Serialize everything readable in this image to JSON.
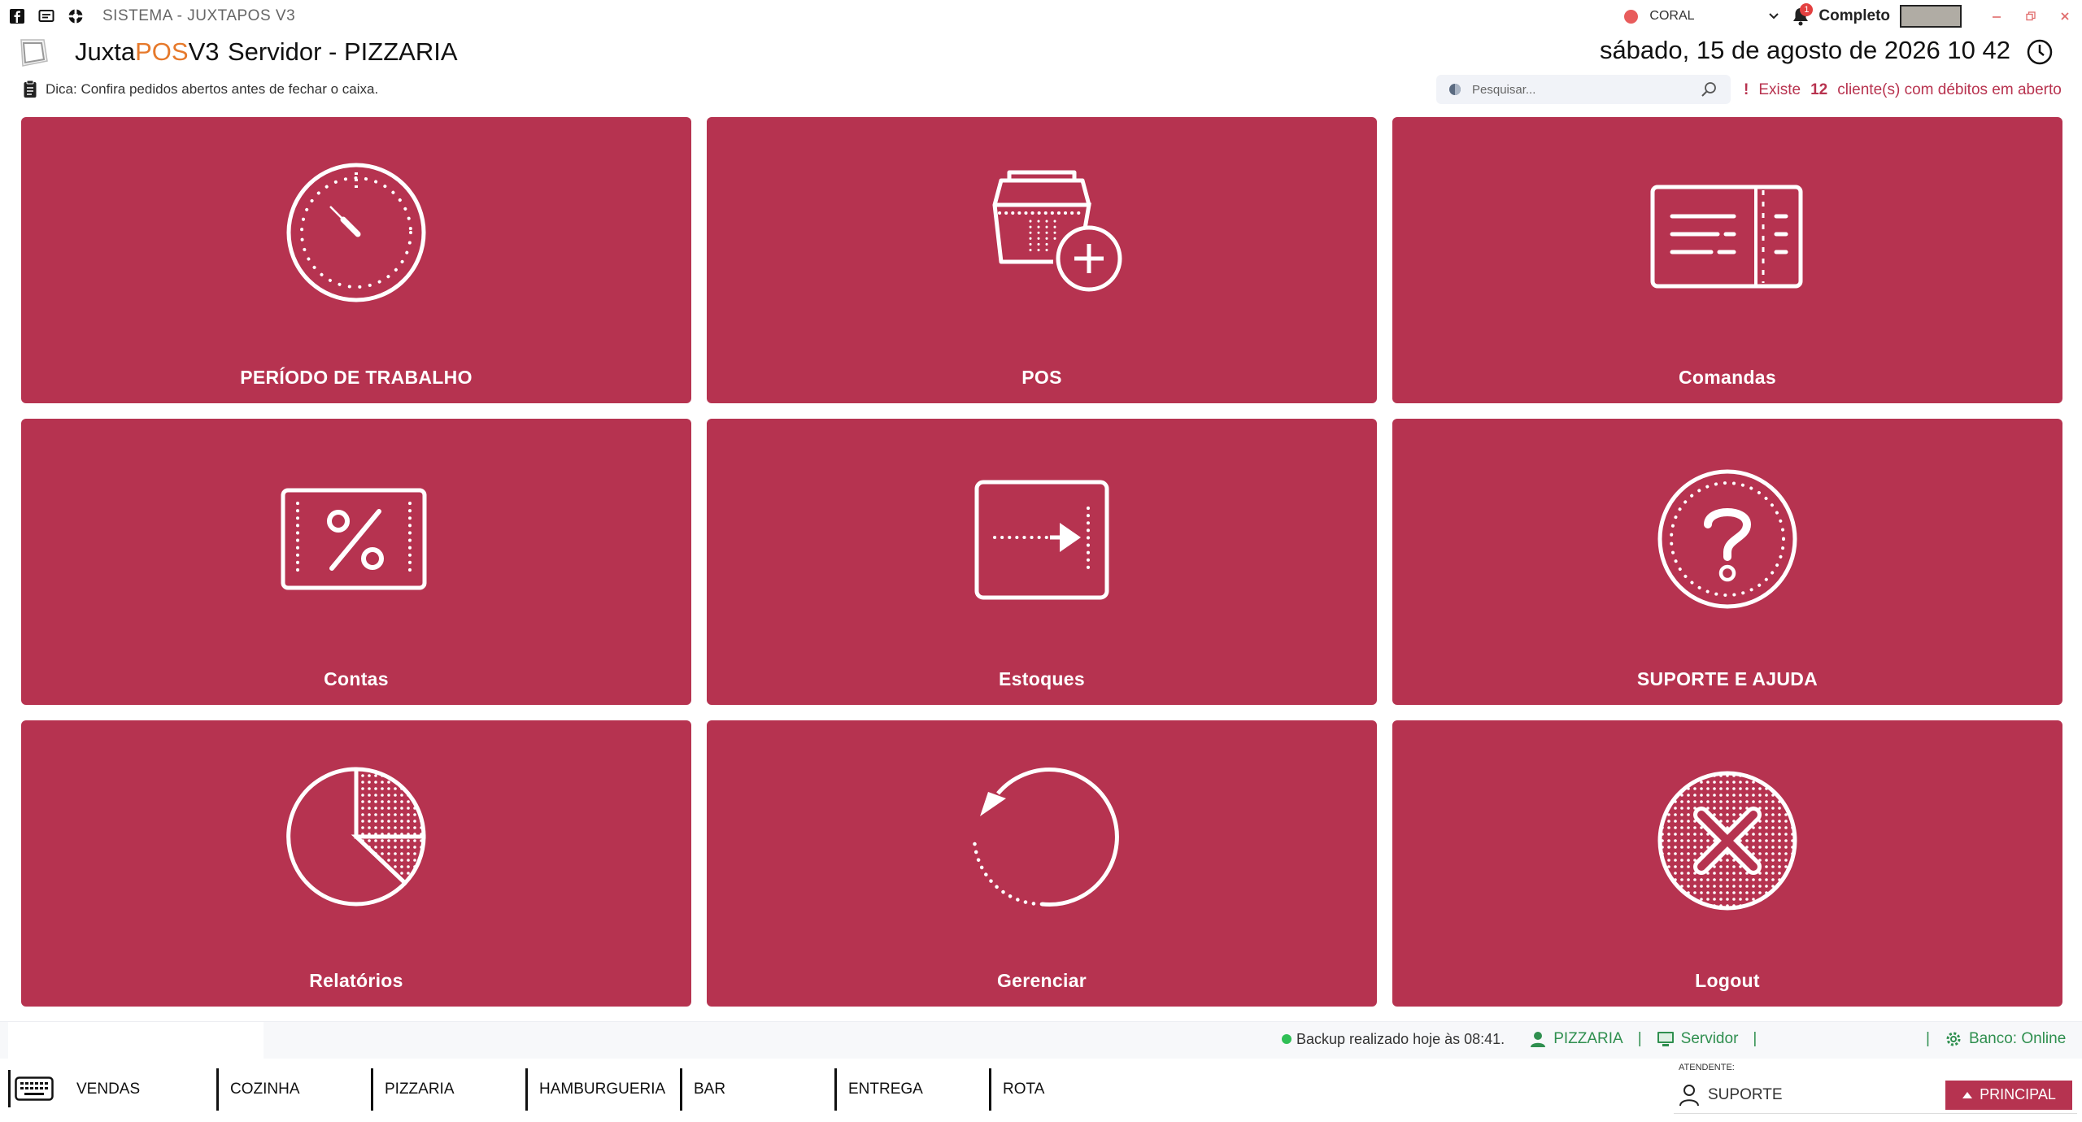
{
  "window": {
    "title": "SISTEMA - JUXTAPOS V3",
    "company": "CORAL",
    "notifications_count": "1",
    "mode_label": "Completo"
  },
  "header": {
    "app_name_prefix": "Juxta",
    "app_name_accent": "POS",
    "app_name_suffix": "V3",
    "server_label": "Servidor - PIZZARIA",
    "datetime": "sábado, 15 de agosto de 2026 10 42"
  },
  "tip": {
    "text": "Dica: Confira pedidos abertos antes de fechar o caixa."
  },
  "search": {
    "placeholder": "Pesquisar..."
  },
  "debt_notice": {
    "mark": "!",
    "prefix": "Existe",
    "count": "12",
    "suffix": "cliente(s) com débitos em aberto"
  },
  "tiles": [
    {
      "label": "PERÍODO DE TRABALHO",
      "icon": "stopwatch-icon"
    },
    {
      "label": "POS",
      "icon": "basket-add-icon"
    },
    {
      "label": "Comandas",
      "icon": "ticket-icon"
    },
    {
      "label": "Contas",
      "icon": "percent-coupon-icon"
    },
    {
      "label": "Estoques",
      "icon": "arrow-in-box-icon"
    },
    {
      "label": "SUPORTE E AJUDA",
      "icon": "question-icon"
    },
    {
      "label": "Relatórios",
      "icon": "pie-chart-icon"
    },
    {
      "label": "Gerenciar",
      "icon": "refresh-icon"
    },
    {
      "label": "Logout",
      "icon": "close-circle-icon"
    }
  ],
  "status": {
    "backup": "Backup realizado hoje às 08:41.",
    "store": "PIZZARIA",
    "server": "Servidor",
    "bank": "Banco: Online"
  },
  "tabs": [
    "VENDAS",
    "COZINHA",
    "PIZZARIA",
    "HAMBURGUERIA",
    "BAR",
    "ENTREGA",
    "ROTA"
  ],
  "attendant": {
    "label": "ATENDENTE:",
    "name": "SUPORTE",
    "button": "PRINCIPAL"
  },
  "colors": {
    "tile": "#b63350",
    "accent": "#e6792b",
    "status_green": "#2f8f4f",
    "alert_red": "#b8334f"
  }
}
